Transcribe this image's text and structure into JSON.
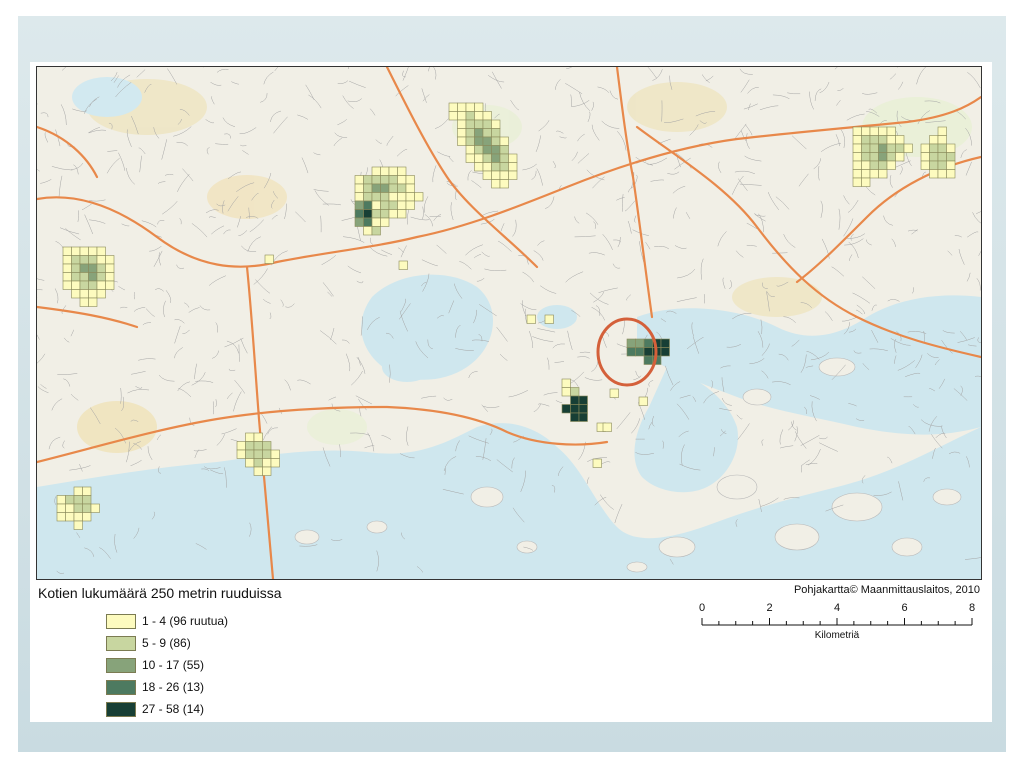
{
  "legend": {
    "title": "Kotien lukumäärä 250 metrin ruuduissa",
    "items": [
      {
        "label": "1 - 4  (96 ruutua)",
        "color": "#fdfbbf"
      },
      {
        "label": "5 - 9  (86)",
        "color": "#c8d6a0"
      },
      {
        "label": "10 - 17  (55)",
        "color": "#87a37a"
      },
      {
        "label": "18 - 26  (13)",
        "color": "#4d7a60"
      },
      {
        "label": "27 - 58  (14)",
        "color": "#173f35"
      }
    ]
  },
  "credit": "Pohjakartta© Maanmittauslaitos,  2010",
  "scale": {
    "ticks": [
      "0",
      "2",
      "4",
      "6",
      "8"
    ],
    "unit": "Kilometriä"
  },
  "colors": {
    "sea": "#cfe7ee",
    "land": "#f2f0e8",
    "road_major": "#e8884a",
    "highlight_circle": "#d4603a"
  }
}
